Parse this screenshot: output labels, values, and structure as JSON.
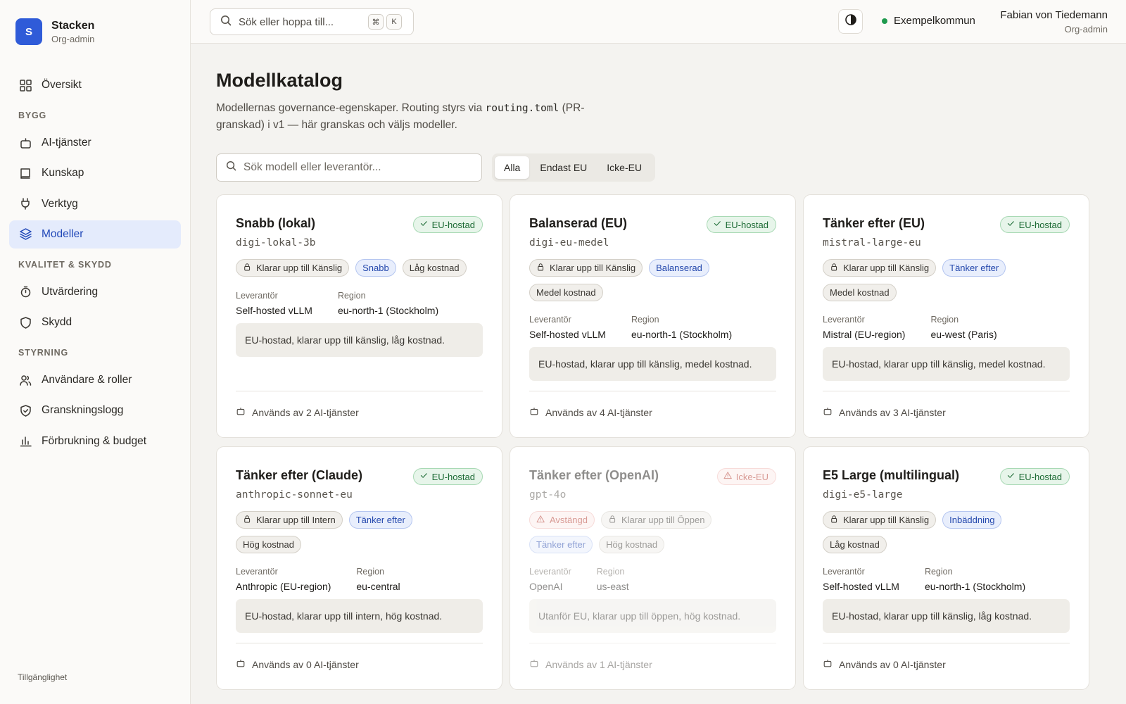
{
  "app": {
    "name": "Stacken",
    "role": "Org-admin",
    "logo_letter": "S",
    "accent": "#2f5bd8"
  },
  "sidebar": {
    "top_items": [
      {
        "label": "Översikt",
        "icon": "grid-icon"
      }
    ],
    "sections": [
      {
        "title": "BYGG",
        "items": [
          {
            "label": "AI-tjänster",
            "icon": "bot-icon"
          },
          {
            "label": "Kunskap",
            "icon": "book-icon"
          },
          {
            "label": "Verktyg",
            "icon": "plug-icon"
          },
          {
            "label": "Modeller",
            "icon": "layers-icon",
            "active": true
          }
        ]
      },
      {
        "title": "KVALITET & SKYDD",
        "items": [
          {
            "label": "Utvärdering",
            "icon": "timer-icon"
          },
          {
            "label": "Skydd",
            "icon": "shield-icon"
          }
        ]
      },
      {
        "title": "STYRNING",
        "items": [
          {
            "label": "Användare & roller",
            "icon": "users-icon"
          },
          {
            "label": "Granskningslogg",
            "icon": "shield-check-icon"
          },
          {
            "label": "Förbrukning & budget",
            "icon": "bar-chart-icon"
          }
        ]
      }
    ],
    "footer": "Tillgänglighet"
  },
  "topbar": {
    "search_placeholder": "Sök eller hoppa till...",
    "shortcut": [
      "⌘",
      "K"
    ],
    "org": "Exempelkommun",
    "org_status_color": "#1f9a4e",
    "user_name": "Fabian von Tiedemann",
    "user_role": "Org-admin"
  },
  "page": {
    "title": "Modellkatalog",
    "desc_before": "Modellernas governance-egenskaper. Routing styrs via ",
    "desc_code": "routing.toml",
    "desc_after": " (PR-granskad) i v1 — här granskas och väljs modeller.",
    "search_placeholder": "Sök modell eller leverantör...",
    "filters": [
      "Alla",
      "Endast EU",
      "Icke-EU"
    ],
    "active_filter": "Alla"
  },
  "labels": {
    "provider": "Leverantör",
    "region": "Region"
  },
  "models": [
    {
      "name": "Snabb (lokal)",
      "id": "digi-lokal-3b",
      "host": "EU-hostad",
      "eu": true,
      "disabled": false,
      "chips": [
        {
          "text": "Klarar upp till Känslig",
          "kind": "gray",
          "icon": "lock-icon"
        },
        {
          "text": "Snabb",
          "kind": "blue"
        },
        {
          "text": "Låg kostnad",
          "kind": "gray"
        }
      ],
      "provider": "Self-hosted vLLM",
      "region": "eu-north-1 (Stockholm)",
      "summary": "EU-hostad, klarar upp till känslig, låg kostnad.",
      "usage": "Används av 2 AI-tjänster"
    },
    {
      "name": "Balanserad (EU)",
      "id": "digi-eu-medel",
      "host": "EU-hostad",
      "eu": true,
      "disabled": false,
      "chips": [
        {
          "text": "Klarar upp till Känslig",
          "kind": "gray",
          "icon": "lock-icon"
        },
        {
          "text": "Balanserad",
          "kind": "blue"
        },
        {
          "text": "Medel kostnad",
          "kind": "gray"
        }
      ],
      "provider": "Self-hosted vLLM",
      "region": "eu-north-1 (Stockholm)",
      "summary": "EU-hostad, klarar upp till känslig, medel kostnad.",
      "usage": "Används av 4 AI-tjänster"
    },
    {
      "name": "Tänker efter (EU)",
      "id": "mistral-large-eu",
      "host": "EU-hostad",
      "eu": true,
      "disabled": false,
      "chips": [
        {
          "text": "Klarar upp till Känslig",
          "kind": "gray",
          "icon": "lock-icon"
        },
        {
          "text": "Tänker efter",
          "kind": "blue"
        },
        {
          "text": "Medel kostnad",
          "kind": "gray"
        }
      ],
      "provider": "Mistral (EU-region)",
      "region": "eu-west (Paris)",
      "summary": "EU-hostad, klarar upp till känslig, medel kostnad.",
      "usage": "Används av 3 AI-tjänster"
    },
    {
      "name": "Tänker efter (Claude)",
      "id": "anthropic-sonnet-eu",
      "host": "EU-hostad",
      "eu": true,
      "disabled": false,
      "chips": [
        {
          "text": "Klarar upp till Intern",
          "kind": "gray",
          "icon": "lock-icon"
        },
        {
          "text": "Tänker efter",
          "kind": "blue"
        },
        {
          "text": "Hög kostnad",
          "kind": "gray"
        }
      ],
      "provider": "Anthropic (EU-region)",
      "region": "eu-central",
      "summary": "EU-hostad, klarar upp till intern, hög kostnad.",
      "usage": "Används av 0 AI-tjänster"
    },
    {
      "name": "Tänker efter (OpenAI)",
      "id": "gpt-4o",
      "host": "Icke-EU",
      "eu": false,
      "disabled": true,
      "chips": [
        {
          "text": "Avstängd",
          "kind": "red",
          "icon": "warning-icon"
        },
        {
          "text": "Klarar upp till Öppen",
          "kind": "gray",
          "icon": "lock-icon"
        },
        {
          "text": "Tänker efter",
          "kind": "blue"
        },
        {
          "text": "Hög kostnad",
          "kind": "gray"
        }
      ],
      "provider": "OpenAI",
      "region": "us-east",
      "summary": "Utanför EU, klarar upp till öppen, hög kostnad.",
      "usage": "Används av 1 AI-tjänster"
    },
    {
      "name": "E5 Large (multilingual)",
      "id": "digi-e5-large",
      "host": "EU-hostad",
      "eu": true,
      "disabled": false,
      "chips": [
        {
          "text": "Klarar upp till Känslig",
          "kind": "gray",
          "icon": "lock-icon"
        },
        {
          "text": "Inbäddning",
          "kind": "blue"
        },
        {
          "text": "Låg kostnad",
          "kind": "gray"
        }
      ],
      "provider": "Self-hosted vLLM",
      "region": "eu-north-1 (Stockholm)",
      "summary": "EU-hostad, klarar upp till känslig, låg kostnad.",
      "usage": "Används av 0 AI-tjänster"
    }
  ]
}
